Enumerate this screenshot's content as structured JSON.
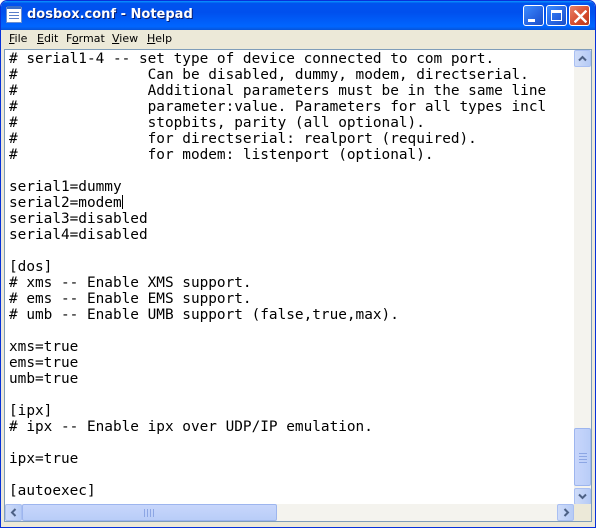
{
  "window": {
    "title": "dosbox.conf - Notepad"
  },
  "menu": {
    "file": {
      "accel": "F",
      "rest": "ile"
    },
    "edit": {
      "accel": "E",
      "rest": "dit"
    },
    "format": {
      "pre": "F",
      "accel": "o",
      "rest": "rmat"
    },
    "view": {
      "accel": "V",
      "rest": "iew"
    },
    "help": {
      "accel": "H",
      "rest": "elp"
    }
  },
  "document": {
    "lines": [
      "# serial1-4 -- set type of device connected to com port.",
      "#               Can be disabled, dummy, modem, directserial.",
      "#               Additional parameters must be in the same line",
      "#               parameter:value. Parameters for all types incl",
      "#               stopbits, parity (all optional).",
      "#               for directserial: realport (required).",
      "#               for modem: listenport (optional).",
      "",
      "serial1=dummy",
      "serial2=modem",
      "serial3=disabled",
      "serial4=disabled",
      "",
      "[dos]",
      "# xms -- Enable XMS support.",
      "# ems -- Enable EMS support.",
      "# umb -- Enable UMB support (false,true,max).",
      "",
      "xms=true",
      "ems=true",
      "umb=true",
      "",
      "[ipx]",
      "# ipx -- Enable ipx over UDP/IP emulation.",
      "",
      "ipx=true",
      "",
      "[autoexec]"
    ],
    "caret_line": 9
  },
  "colors": {
    "titlebar": "#0053ee",
    "close_button": "#d64a2c",
    "chrome": "#ece9d8"
  }
}
